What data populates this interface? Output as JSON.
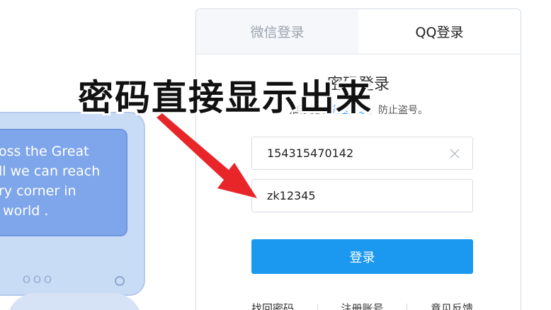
{
  "illustration": {
    "screen_text": "oss the Great\nll we can reach\nry corner in\n world .",
    "dots": "OOO"
  },
  "tabs": [
    {
      "label": "微信登录",
      "active": false
    },
    {
      "label": "QQ登录",
      "active": true
    }
  ],
  "card": {
    "title": "密码登录",
    "subtitle_prefix": "推荐使用",
    "subtitle_link": "快速登录",
    "subtitle_suffix": "，防止盗号。"
  },
  "form": {
    "account_value": "154315470142",
    "password_value": "zk12345",
    "login_label": "登录"
  },
  "footer": {
    "forgot_password": "找回密码",
    "register": "注册账号",
    "feedback": "意见反馈"
  },
  "annotation": {
    "caption": "密码直接显示出来"
  },
  "colors": {
    "accent": "#1b98f0",
    "arrow": "#e8262a",
    "link": "#1e8ff0"
  },
  "icons": {
    "clear": "close-icon",
    "arrow": "arrow-icon"
  }
}
